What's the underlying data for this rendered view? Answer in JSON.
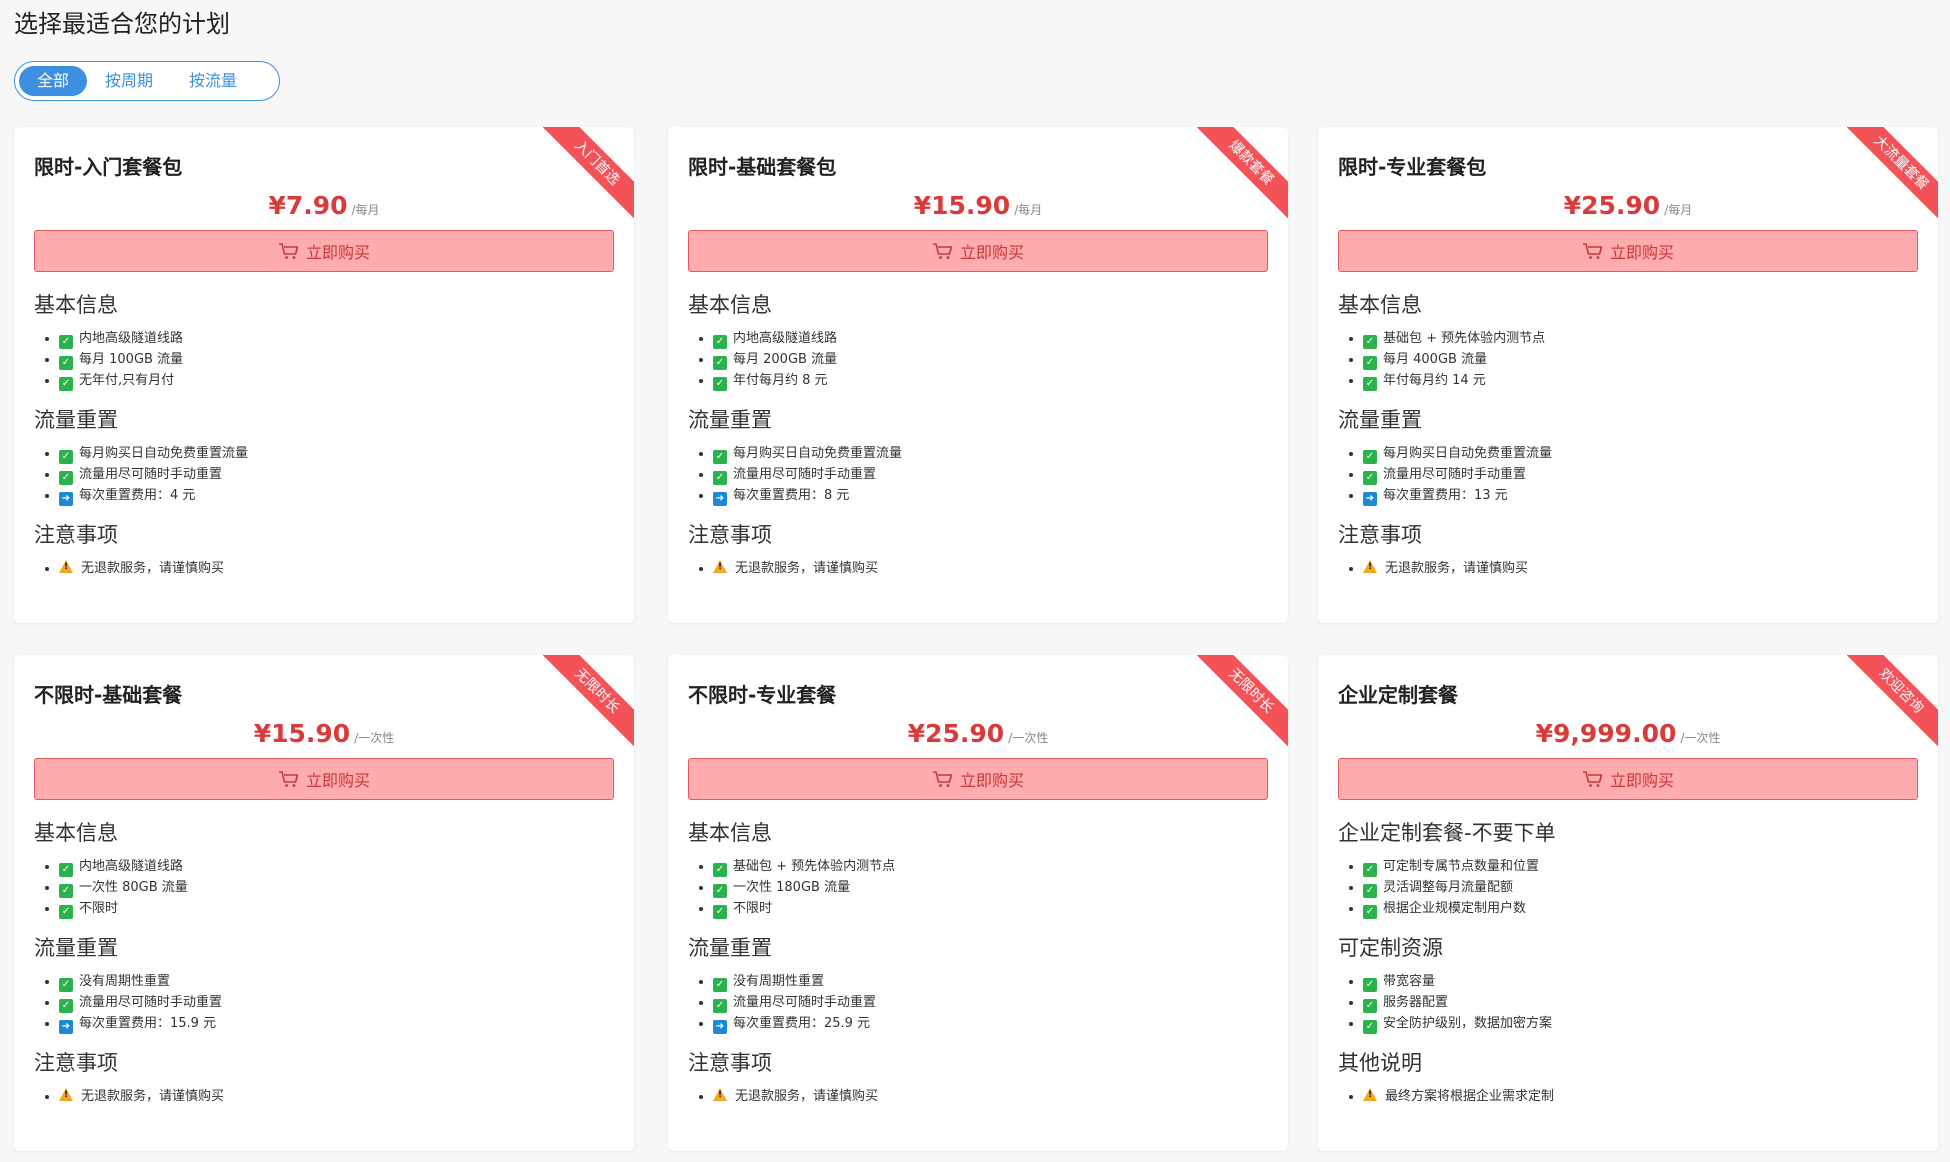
{
  "page_title": "选择最适合您的计划",
  "filters": [
    "全部",
    "按周期",
    "按流量"
  ],
  "active_filter": 0,
  "buy_label": "立即购买",
  "icons": {
    "cart": "cart-icon",
    "check": "check-icon",
    "arrow": "arrow-right-icon",
    "warning": "warning-icon"
  },
  "colors": {
    "accent": "#3e8fe0",
    "price": "#d93a3a",
    "ribbon": "#f25258",
    "button_bg": "#ffacaf",
    "check": "#2bb24c",
    "arrow": "#1d8ad6",
    "warning": "#f5a623"
  },
  "plans": [
    {
      "ribbon": "入门首选",
      "name": "限时-入门套餐包",
      "price": "¥7.90",
      "period": "/每月",
      "sections": [
        {
          "title": "基本信息",
          "items": [
            {
              "icon": "check",
              "text": "内地高级隧道线路"
            },
            {
              "icon": "check",
              "text": "每月 100GB 流量"
            },
            {
              "icon": "check",
              "text": "无年付,只有月付"
            }
          ]
        },
        {
          "title": "流量重置",
          "items": [
            {
              "icon": "check",
              "text": "每月购买日自动免费重置流量"
            },
            {
              "icon": "check",
              "text": "流量用尽可随时手动重置"
            },
            {
              "icon": "arrow",
              "text": "每次重置费用：4 元"
            }
          ]
        },
        {
          "title": "注意事项",
          "items": [
            {
              "icon": "warning",
              "text": "无退款服务，请谨慎购买"
            }
          ]
        }
      ]
    },
    {
      "ribbon": "爆款套餐",
      "name": "限时-基础套餐包",
      "price": "¥15.90",
      "period": "/每月",
      "sections": [
        {
          "title": "基本信息",
          "items": [
            {
              "icon": "check",
              "text": "内地高级隧道线路"
            },
            {
              "icon": "check",
              "text": "每月 200GB 流量"
            },
            {
              "icon": "check",
              "text": "年付每月约 8 元"
            }
          ]
        },
        {
          "title": "流量重置",
          "items": [
            {
              "icon": "check",
              "text": "每月购买日自动免费重置流量"
            },
            {
              "icon": "check",
              "text": "流量用尽可随时手动重置"
            },
            {
              "icon": "arrow",
              "text": "每次重置费用：8 元"
            }
          ]
        },
        {
          "title": "注意事项",
          "items": [
            {
              "icon": "warning",
              "text": "无退款服务，请谨慎购买"
            }
          ]
        }
      ]
    },
    {
      "ribbon": "大流量套餐",
      "name": "限时-专业套餐包",
      "price": "¥25.90",
      "period": "/每月",
      "sections": [
        {
          "title": "基本信息",
          "items": [
            {
              "icon": "check",
              "text": "基础包 + 预先体验内测节点"
            },
            {
              "icon": "check",
              "text": "每月 400GB 流量"
            },
            {
              "icon": "check",
              "text": "年付每月约 14 元"
            }
          ]
        },
        {
          "title": "流量重置",
          "items": [
            {
              "icon": "check",
              "text": "每月购买日自动免费重置流量"
            },
            {
              "icon": "check",
              "text": "流量用尽可随时手动重置"
            },
            {
              "icon": "arrow",
              "text": "每次重置费用：13 元"
            }
          ]
        },
        {
          "title": "注意事项",
          "items": [
            {
              "icon": "warning",
              "text": "无退款服务，请谨慎购买"
            }
          ]
        }
      ]
    },
    {
      "ribbon": "无限时长",
      "name": "不限时-基础套餐",
      "price": "¥15.90",
      "period": "/一次性",
      "sections": [
        {
          "title": "基本信息",
          "items": [
            {
              "icon": "check",
              "text": "内地高级隧道线路"
            },
            {
              "icon": "check",
              "text": "一次性 80GB 流量"
            },
            {
              "icon": "check",
              "text": "不限时"
            }
          ]
        },
        {
          "title": "流量重置",
          "items": [
            {
              "icon": "check",
              "text": "没有周期性重置"
            },
            {
              "icon": "check",
              "text": "流量用尽可随时手动重置"
            },
            {
              "icon": "arrow",
              "text": "每次重置费用：15.9 元"
            }
          ]
        },
        {
          "title": "注意事项",
          "items": [
            {
              "icon": "warning",
              "text": "无退款服务，请谨慎购买"
            }
          ]
        }
      ]
    },
    {
      "ribbon": "无限时长",
      "name": "不限时-专业套餐",
      "price": "¥25.90",
      "period": "/一次性",
      "sections": [
        {
          "title": "基本信息",
          "items": [
            {
              "icon": "check",
              "text": "基础包 + 预先体验内测节点"
            },
            {
              "icon": "check",
              "text": "一次性 180GB 流量"
            },
            {
              "icon": "check",
              "text": "不限时"
            }
          ]
        },
        {
          "title": "流量重置",
          "items": [
            {
              "icon": "check",
              "text": "没有周期性重置"
            },
            {
              "icon": "check",
              "text": "流量用尽可随时手动重置"
            },
            {
              "icon": "arrow",
              "text": "每次重置费用：25.9 元"
            }
          ]
        },
        {
          "title": "注意事项",
          "items": [
            {
              "icon": "warning",
              "text": "无退款服务，请谨慎购买"
            }
          ]
        }
      ]
    },
    {
      "ribbon": "欢迎咨询",
      "name": "企业定制套餐",
      "price": "¥9,999.00",
      "period": "/一次性",
      "sections": [
        {
          "title": "企业定制套餐-不要下单",
          "items": [
            {
              "icon": "check",
              "text": "可定制专属节点数量和位置"
            },
            {
              "icon": "check",
              "text": "灵活调整每月流量配额"
            },
            {
              "icon": "check",
              "text": "根据企业规模定制用户数"
            }
          ]
        },
        {
          "title": "可定制资源",
          "items": [
            {
              "icon": "check",
              "text": "带宽容量"
            },
            {
              "icon": "check",
              "text": "服务器配置"
            },
            {
              "icon": "check",
              "text": "安全防护级别，数据加密方案"
            }
          ]
        },
        {
          "title": "其他说明",
          "items": [
            {
              "icon": "warning",
              "text": "最终方案将根据企业需求定制"
            }
          ]
        }
      ]
    }
  ]
}
